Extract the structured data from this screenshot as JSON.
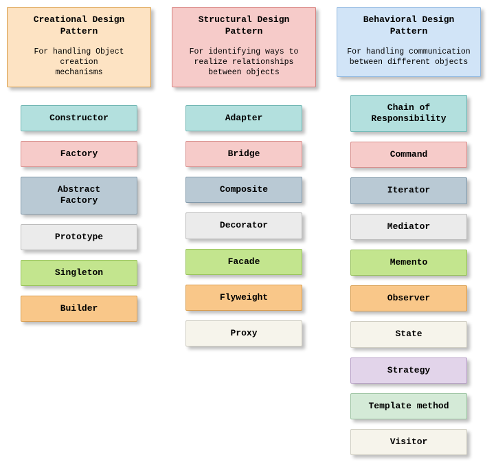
{
  "columns": [
    {
      "key": "creational",
      "title": "Creational Design\nPattern",
      "desc": "For handling Object creation\nmechanisms",
      "headerClass": "hdr-creational",
      "items": [
        "Constructor",
        "Factory",
        "Abstract\nFactory",
        "Prototype",
        "Singleton",
        "Builder"
      ]
    },
    {
      "key": "structural",
      "title": "Structural Design\nPattern",
      "desc": "For identifying ways to\nrealize relationships\nbetween objects",
      "headerClass": "hdr-structural",
      "items": [
        "Adapter",
        "Bridge",
        "Composite",
        "Decorator",
        "Facade",
        "Flyweight",
        "Proxy"
      ]
    },
    {
      "key": "behavioral",
      "title": "Behavioral Design\nPattern",
      "desc": "For handling communication\nbetween different objects",
      "headerClass": "hdr-behavioral",
      "items": [
        "Chain of Responsibility",
        "Command",
        "Iterator",
        "Mediator",
        "Memento",
        "Observer",
        "State",
        "Strategy",
        "Template method",
        "Visitor"
      ]
    }
  ],
  "colorClasses": [
    "c0",
    "c1",
    "c2",
    "c3",
    "c4",
    "c5",
    "c6",
    "c7",
    "c8",
    "c9"
  ]
}
